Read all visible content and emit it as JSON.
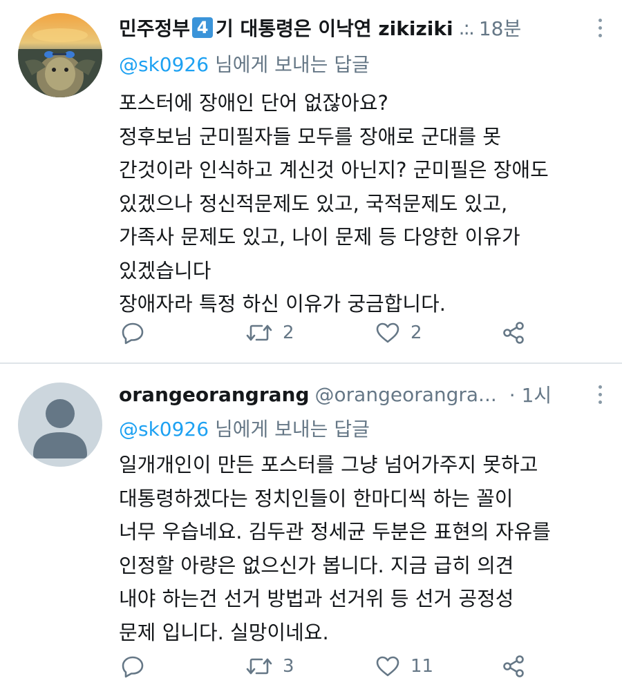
{
  "tweets": [
    {
      "author_name_part1": "민주정부",
      "author_name_badge": "4",
      "author_name_part2": "기 대통령은 이낙연 zikiziki",
      "handle": "",
      "truncation": ".:.",
      "time": "18분",
      "reply_prefix": "@sk0926",
      "reply_suffix": " 님에게 보내는 답글",
      "body_lines": [
        "포스터에 장애인 단어 없잖아요?",
        "정후보님 군미필자들 모두를 장애로 군대를 못",
        "간것이라 인식하고 계신것 아닌지? 군미필은 장애도",
        "있겠으나 정신적문제도 있고, 국적문제도 있고,",
        "가족사 문제도 있고, 나이 문제 등 다양한 이유가",
        "있겠습니다",
        "장애자라 특정 하신 이유가 궁금합니다."
      ],
      "retweets": "2",
      "likes": "2",
      "avatar": "turtle-photo"
    },
    {
      "author_name": "orangeorangrang",
      "handle": "@orangeorangra...",
      "time": "· 1시",
      "reply_prefix": "@sk0926",
      "reply_suffix": " 님에게 보내는 답글",
      "body_lines": [
        "일개개인이 만든 포스터를 그냥 넘어가주지 못하고",
        "대통령하겠다는 정치인들이 한마디씩 하는 꼴이",
        "너무 우습네요. 김두관 정세균 두분은 표현의 자유를",
        "인정할 아량은 없으신가 봅니다. 지금 급히 의견",
        "내야 하는건 선거 방법과 선거위 등 선거 공정성",
        "문제 입니다. 실망이네요."
      ],
      "retweets": "3",
      "likes": "11",
      "avatar": "default-profile"
    }
  ],
  "colors": {
    "text": "#14171a",
    "secondary": "#657786",
    "link": "#1da1f2",
    "divider": "#dfe4e8",
    "badge": "#3b94d9"
  },
  "icons": [
    "reply-icon",
    "retweet-icon",
    "like-icon",
    "share-icon",
    "more-icon"
  ]
}
